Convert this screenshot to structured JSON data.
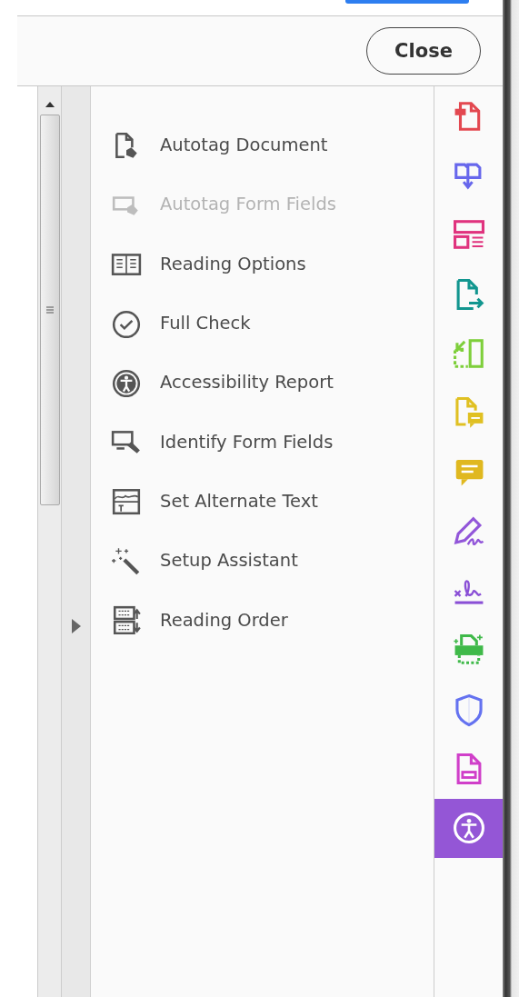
{
  "header": {
    "close_button": "Close"
  },
  "tools": [
    {
      "kind": "autotag-document",
      "label": "Autotag Document",
      "disabled": false
    },
    {
      "kind": "autotag-form",
      "label": "Autotag Form Fields",
      "disabled": true
    },
    {
      "kind": "reading-options",
      "label": "Reading Options",
      "disabled": false
    },
    {
      "kind": "full-check",
      "label": "Full Check",
      "disabled": false
    },
    {
      "kind": "accessibility",
      "label": "Accessibility Report",
      "disabled": false
    },
    {
      "kind": "identify-fields",
      "label": "Identify Form Fields",
      "disabled": false
    },
    {
      "kind": "alt-text",
      "label": "Set Alternate Text",
      "disabled": false
    },
    {
      "kind": "wand",
      "label": "Setup Assistant",
      "disabled": false
    },
    {
      "kind": "reading-order",
      "label": "Reading Order",
      "disabled": false
    }
  ],
  "rail": [
    {
      "kind": "create",
      "color": "#e34850",
      "selected": false
    },
    {
      "kind": "combine",
      "color": "#6767ec",
      "selected": false
    },
    {
      "kind": "organize",
      "color": "#e0337e",
      "selected": false
    },
    {
      "kind": "export",
      "color": "#12968f",
      "selected": false
    },
    {
      "kind": "crop",
      "color": "#7ecf3b",
      "selected": false
    },
    {
      "kind": "doc-comment",
      "color": "#e0c022",
      "selected": false
    },
    {
      "kind": "comment",
      "color": "#e0b81f",
      "selected": false
    },
    {
      "kind": "fill-sign",
      "color": "#9256d9",
      "selected": false
    },
    {
      "kind": "sign",
      "color": "#8a4fd6",
      "selected": false
    },
    {
      "kind": "print",
      "color": "#3fb949",
      "selected": false
    },
    {
      "kind": "protect",
      "color": "#6472f0",
      "selected": false
    },
    {
      "kind": "redact",
      "color": "#d03fc9",
      "selected": false
    },
    {
      "kind": "accessibility",
      "color": "#9456d6",
      "selected": true
    }
  ]
}
